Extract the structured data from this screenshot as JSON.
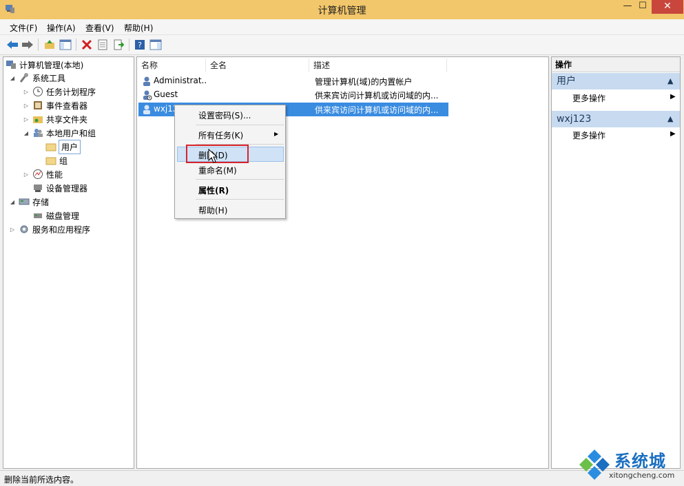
{
  "window": {
    "title": "计算机管理",
    "min": "—",
    "max": "☐",
    "close": "✕"
  },
  "menu": [
    "文件(F)",
    "操作(A)",
    "查看(V)",
    "帮助(H)"
  ],
  "tree": [
    {
      "label": "计算机管理(本地)"
    },
    {
      "label": "系统工具"
    },
    {
      "label": "任务计划程序"
    },
    {
      "label": "事件查看器"
    },
    {
      "label": "共享文件夹"
    },
    {
      "label": "本地用户和组"
    },
    {
      "label": "用户"
    },
    {
      "label": "组"
    },
    {
      "label": "性能"
    },
    {
      "label": "设备管理器"
    },
    {
      "label": "存储"
    },
    {
      "label": "磁盘管理"
    },
    {
      "label": "服务和应用程序"
    }
  ],
  "columns": [
    "名称",
    "全名",
    "描述"
  ],
  "rows": [
    {
      "name": "Administrat...",
      "fullname": "",
      "desc": "管理计算机(域)的内置帐户"
    },
    {
      "name": "Guest",
      "fullname": "",
      "desc": "供来宾访问计算机或访问域的内..."
    },
    {
      "name": "wxj12",
      "fullname": "",
      "desc": "供来宾访问计算机或访问域的内..."
    }
  ],
  "context_menu": {
    "items": [
      "设置密码(S)...",
      "所有任务(K)",
      "删除(D)",
      "重命名(M)",
      "属性(R)",
      "帮助(H)"
    ],
    "submenu_arrow": "▶"
  },
  "actions": {
    "title": "操作",
    "sections": [
      {
        "label": "用户",
        "item": "更多操作"
      },
      {
        "label": "wxj123",
        "item": "更多操作"
      }
    ],
    "collapse": "▲",
    "arrow": "▶"
  },
  "status": "删除当前所选内容。",
  "watermark": {
    "brand": "系统城",
    "url": "xitongcheng.com"
  },
  "colors": {
    "titlebar": "#f2c66a",
    "selection": "#3a8ce0",
    "close": "#c9463d",
    "highlight_box": "#d8232a"
  }
}
